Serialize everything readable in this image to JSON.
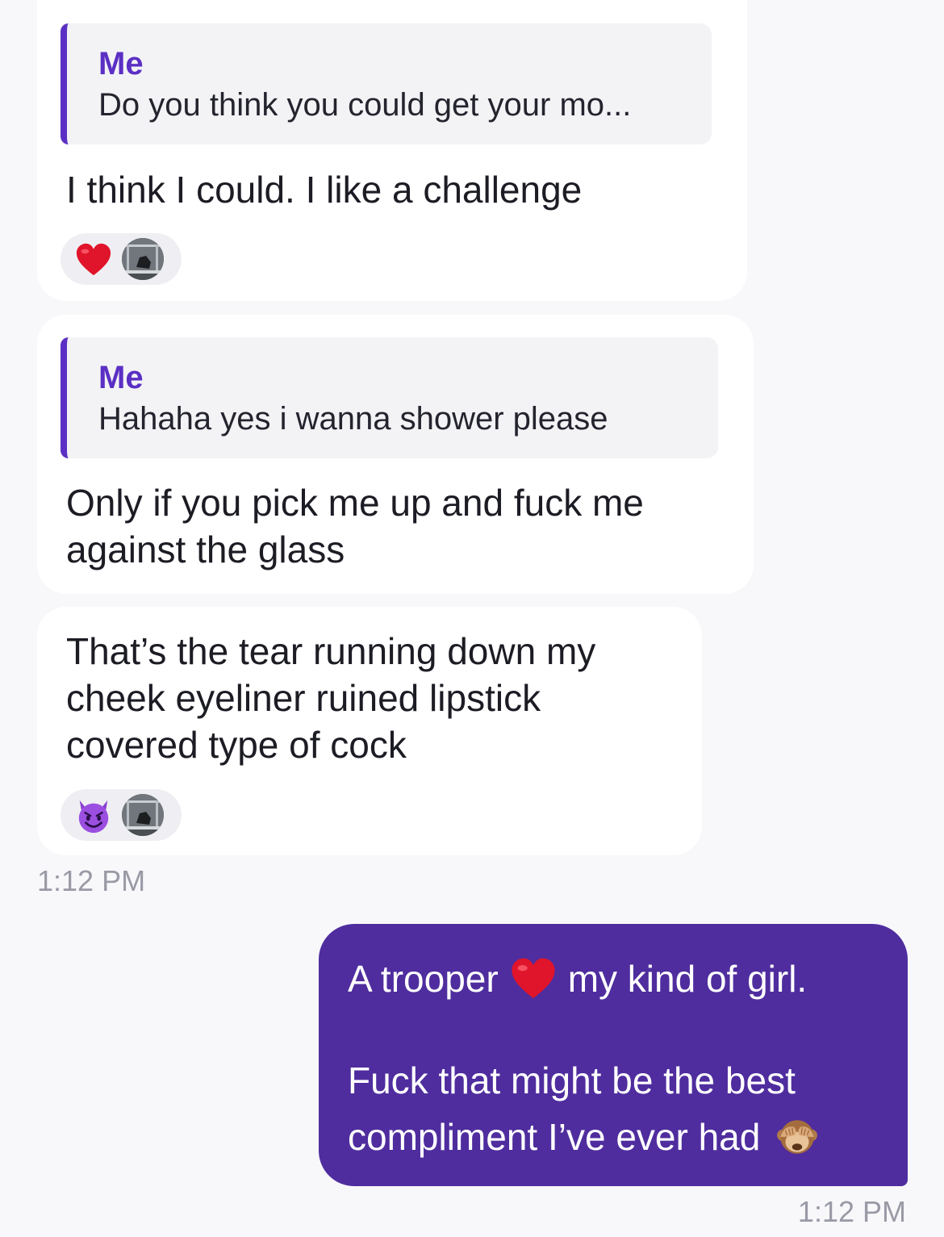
{
  "messages": [
    {
      "quote_author": "Me",
      "quote_text": "Do you think you could get your mo...",
      "text": "I think I could. I like a challenge",
      "reaction_icon": "heart-icon"
    },
    {
      "quote_author": "Me",
      "quote_text": "Hahaha yes i wanna shower please",
      "text_lines": [
        "Only if you pick me up and fuck me",
        "against the glass"
      ]
    },
    {
      "text_lines": [
        "That’s the tear running down my",
        "cheek eyeliner ruined lipstick",
        "covered type of cock"
      ],
      "reaction_icon": "smiling-devil-icon"
    }
  ],
  "incoming_time": "1:12 PM",
  "outgoing": {
    "line1_before": "A trooper",
    "line1_emoji": "heart-icon",
    "line1_after": "my kind of girl.",
    "line2": "Fuck that might be the best",
    "line3": "compliment I’ve ever had",
    "line3_emoji": "see-no-evil-monkey-icon",
    "time": "1:12 PM"
  },
  "colors": {
    "accent": "#5b2fc4",
    "outgoing_bubble": "#4f2d9e",
    "background": "#f8f8fb",
    "incoming_bubble": "#ffffff",
    "timestamp": "#9a9aa6"
  }
}
